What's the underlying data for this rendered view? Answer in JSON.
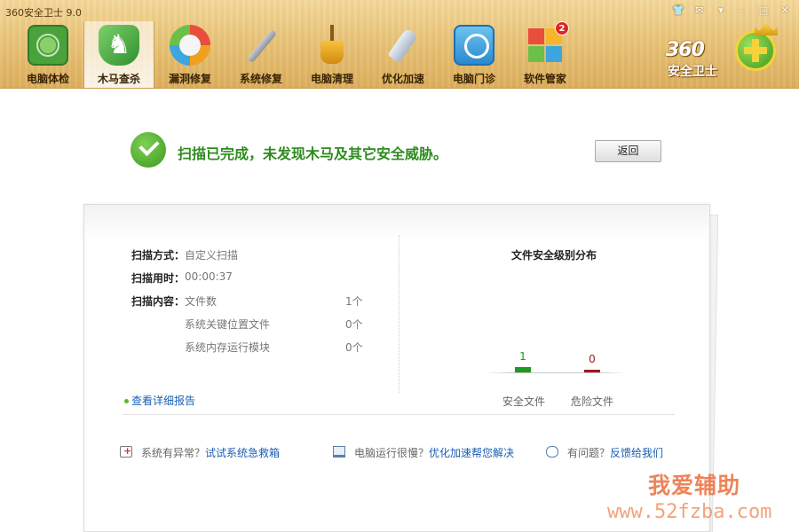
{
  "app": {
    "title": "360安全卫士 9.0",
    "window_controls": [
      "👕",
      "✉",
      "▾",
      "–",
      "□",
      "✕"
    ]
  },
  "toolbar": {
    "items": [
      {
        "label": "电脑体检",
        "icon": "radar-icon"
      },
      {
        "label": "木马查杀",
        "icon": "horse-shield-icon",
        "active": true
      },
      {
        "label": "漏洞修复",
        "icon": "patch-icon"
      },
      {
        "label": "系统修复",
        "icon": "wrench-icon"
      },
      {
        "label": "电脑清理",
        "icon": "broom-icon"
      },
      {
        "label": "优化加速",
        "icon": "rocket-icon"
      },
      {
        "label": "电脑门诊",
        "icon": "clinic-icon"
      },
      {
        "label": "软件管家",
        "icon": "apps-icon",
        "badge": "2"
      }
    ]
  },
  "logo": {
    "line1": "360",
    "line2": "安全卫士"
  },
  "result": {
    "message": "扫描已完成，未发现木马及其它安全威胁。",
    "back_label": "返回"
  },
  "scan_info": {
    "method_label": "扫描方式：",
    "method_value": "自定义扫描",
    "time_label": "扫描用时：",
    "time_value": "00:00:37",
    "content_label": "扫描内容：",
    "content_items": [
      {
        "name": "文件数",
        "count": "1个"
      },
      {
        "name": "系统关键位置文件",
        "count": "0个"
      },
      {
        "name": "系统内存运行模块",
        "count": "0个"
      }
    ]
  },
  "chart_data": {
    "type": "bar",
    "title": "文件安全级别分布",
    "categories": [
      "安全文件",
      "危险文件"
    ],
    "values": [
      1,
      0
    ],
    "colors": [
      "#1e9a1e",
      "#a01818"
    ]
  },
  "detail_link": "查看详细报告",
  "tips": [
    {
      "text": "系统有异常？",
      "link": "试试系统急救箱",
      "icon": "first-aid-icon"
    },
    {
      "text": "电脑运行很慢？",
      "link": "优化加速帮您解决",
      "icon": "monitor-icon"
    },
    {
      "text": "有问题？",
      "link": "反馈给我们",
      "icon": "chat-icon"
    }
  ],
  "watermark": {
    "line1": "我爱辅助",
    "line2": "www.52fzba.com"
  }
}
